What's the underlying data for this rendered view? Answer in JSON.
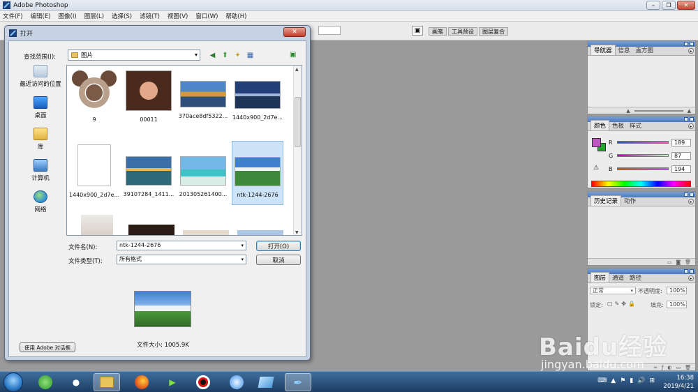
{
  "app": {
    "title": "Adobe Photoshop"
  },
  "menu": [
    "文件(F)",
    "编辑(E)",
    "图像(I)",
    "图层(L)",
    "选择(S)",
    "滤镜(T)",
    "视图(V)",
    "窗口(W)",
    "帮助(H)"
  ],
  "palette_well": {
    "tabs": [
      "画笔",
      "工具预设",
      "图层复合"
    ]
  },
  "navigator_panel": {
    "tabs": [
      "导航器",
      "信息",
      "直方图"
    ]
  },
  "color_panel": {
    "tabs": [
      "颜色",
      "色板",
      "样式"
    ],
    "channels": [
      {
        "label": "R",
        "value": "189"
      },
      {
        "label": "G",
        "value": "87"
      },
      {
        "label": "B",
        "value": "194"
      }
    ],
    "foreground_color": "#BD57C2",
    "background_color": "#22A52F"
  },
  "history_panel": {
    "tabs": [
      "历史记录",
      "动作"
    ]
  },
  "layers_panel": {
    "tabs": [
      "图层",
      "通道",
      "路径"
    ],
    "blend_mode": "正常",
    "opacity_label": "不透明度:",
    "opacity_value": "100%",
    "lock_label": "锁定:",
    "fill_label": "填充:",
    "fill_value": "100%"
  },
  "dialog": {
    "title": "打开",
    "look_in_label": "查找范围(I):",
    "look_in_value": "图片",
    "places": [
      "最近访问的位置",
      "桌面",
      "库",
      "计算机",
      "网络"
    ],
    "files": [
      {
        "name": "9"
      },
      {
        "name": "00011"
      },
      {
        "name": "370ace8df5322..."
      },
      {
        "name": "1440x900_2d7e..."
      },
      {
        "name": "1440x900_2d7e..."
      },
      {
        "name": "39107284_1411..."
      },
      {
        "name": "201305261400..."
      },
      {
        "name": "ntk-1244-2676",
        "selected": true
      }
    ],
    "filename_label": "文件名(N):",
    "filename_value": "ntk-1244-2676",
    "filetype_label": "文件类型(T):",
    "filetype_value": "所有格式",
    "open_button": "打开(O)",
    "cancel_button": "取消",
    "file_size": "文件大小: 1005.9K",
    "adobe_dialog_button": "使用 Adobe 对话框"
  },
  "taskbar": {
    "time": "16:38",
    "date": "2019/4/21"
  },
  "watermark": {
    "text": "Baidu经验",
    "url_text": "jingyan.baidu.com"
  }
}
